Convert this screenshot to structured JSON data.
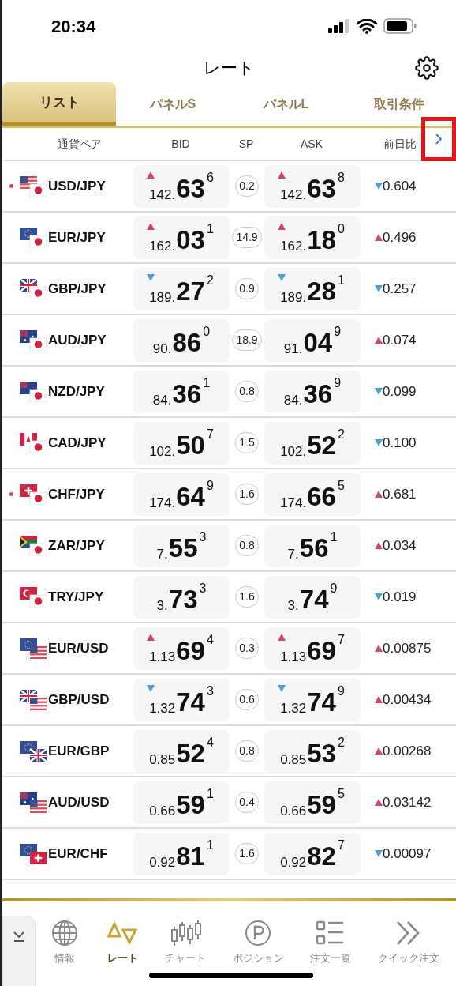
{
  "status_bar": {
    "time": "20:34"
  },
  "header": {
    "title": "レート"
  },
  "tabs": [
    {
      "label": "リスト",
      "selected": true
    },
    {
      "label": "パネルS",
      "selected": false
    },
    {
      "label": "パネルL",
      "selected": false
    },
    {
      "label": "取引条件",
      "selected": false
    }
  ],
  "columns": [
    "通貨ペア",
    "BID",
    "SP",
    "ASK",
    "前日比"
  ],
  "highlighted_next": true,
  "rows": [
    {
      "pair": "USD/JPY",
      "marked": true,
      "flags": [
        {
          "kind": "us"
        },
        {
          "kind": "jp"
        }
      ],
      "bid": {
        "rising": true,
        "falling": false,
        "head": "142.",
        "big": "63",
        "tail": "6"
      },
      "sp": "0.2",
      "ask": {
        "rising": true,
        "falling": false,
        "head": "142.",
        "big": "63",
        "tail": "8"
      },
      "change": {
        "rising": false,
        "value": "0.604"
      }
    },
    {
      "pair": "EUR/JPY",
      "marked": false,
      "flags": [
        {
          "kind": "eu"
        },
        {
          "kind": "jp"
        }
      ],
      "bid": {
        "rising": true,
        "falling": false,
        "head": "162.",
        "big": "03",
        "tail": "1"
      },
      "sp": "14.9",
      "ask": {
        "rising": true,
        "falling": false,
        "head": "162.",
        "big": "18",
        "tail": "0"
      },
      "change": {
        "rising": true,
        "value": "0.496"
      }
    },
    {
      "pair": "GBP/JPY",
      "marked": false,
      "flags": [
        {
          "kind": "gb"
        },
        {
          "kind": "jp"
        }
      ],
      "bid": {
        "rising": false,
        "falling": true,
        "head": "189.",
        "big": "27",
        "tail": "2"
      },
      "sp": "0.9",
      "ask": {
        "rising": false,
        "falling": true,
        "head": "189.",
        "big": "28",
        "tail": "1"
      },
      "change": {
        "rising": false,
        "value": "0.257"
      }
    },
    {
      "pair": "AUD/JPY",
      "marked": false,
      "flags": [
        {
          "kind": "au"
        },
        {
          "kind": "jp"
        }
      ],
      "bid": {
        "rising": false,
        "falling": false,
        "head": "90.",
        "big": "86",
        "tail": "0"
      },
      "sp": "18.9",
      "ask": {
        "rising": false,
        "falling": false,
        "head": "91.",
        "big": "04",
        "tail": "9"
      },
      "change": {
        "rising": true,
        "value": "0.074"
      }
    },
    {
      "pair": "NZD/JPY",
      "marked": false,
      "flags": [
        {
          "kind": "nz"
        },
        {
          "kind": "jp"
        }
      ],
      "bid": {
        "rising": false,
        "falling": false,
        "head": "84.",
        "big": "36",
        "tail": "1"
      },
      "sp": "0.8",
      "ask": {
        "rising": false,
        "falling": false,
        "head": "84.",
        "big": "36",
        "tail": "9"
      },
      "change": {
        "rising": false,
        "value": "0.099"
      }
    },
    {
      "pair": "CAD/JPY",
      "marked": false,
      "flags": [
        {
          "kind": "ca"
        },
        {
          "kind": "jp"
        }
      ],
      "bid": {
        "rising": false,
        "falling": false,
        "head": "102.",
        "big": "50",
        "tail": "7"
      },
      "sp": "1.5",
      "ask": {
        "rising": false,
        "falling": false,
        "head": "102.",
        "big": "52",
        "tail": "2"
      },
      "change": {
        "rising": false,
        "value": "0.100"
      }
    },
    {
      "pair": "CHF/JPY",
      "marked": true,
      "flags": [
        {
          "kind": "ch"
        },
        {
          "kind": "jp"
        }
      ],
      "bid": {
        "rising": false,
        "falling": false,
        "head": "174.",
        "big": "64",
        "tail": "9"
      },
      "sp": "1.6",
      "ask": {
        "rising": false,
        "falling": false,
        "head": "174.",
        "big": "66",
        "tail": "5"
      },
      "change": {
        "rising": true,
        "value": "0.681"
      }
    },
    {
      "pair": "ZAR/JPY",
      "marked": false,
      "flags": [
        {
          "kind": "za"
        },
        {
          "kind": "jp"
        }
      ],
      "bid": {
        "rising": false,
        "falling": false,
        "head": "7.",
        "big": "55",
        "tail": "3"
      },
      "sp": "0.8",
      "ask": {
        "rising": false,
        "falling": false,
        "head": "7.",
        "big": "56",
        "tail": "1"
      },
      "change": {
        "rising": true,
        "value": "0.034"
      }
    },
    {
      "pair": "TRY/JPY",
      "marked": false,
      "flags": [
        {
          "kind": "tr"
        },
        {
          "kind": "jp"
        }
      ],
      "bid": {
        "rising": false,
        "falling": false,
        "head": "3.",
        "big": "73",
        "tail": "3"
      },
      "sp": "1.6",
      "ask": {
        "rising": false,
        "falling": false,
        "head": "3.",
        "big": "74",
        "tail": "9"
      },
      "change": {
        "rising": false,
        "value": "0.019"
      }
    },
    {
      "pair": "EUR/USD",
      "marked": false,
      "flags": [
        {
          "kind": "eu"
        },
        {
          "kind": "us"
        }
      ],
      "bid": {
        "rising": true,
        "falling": false,
        "head": "1.13",
        "big": "69",
        "tail": "4"
      },
      "sp": "0.3",
      "ask": {
        "rising": true,
        "falling": false,
        "head": "1.13",
        "big": "69",
        "tail": "7"
      },
      "change": {
        "rising": true,
        "value": "0.00875"
      }
    },
    {
      "pair": "GBP/USD",
      "marked": false,
      "flags": [
        {
          "kind": "gb"
        },
        {
          "kind": "us"
        }
      ],
      "bid": {
        "rising": false,
        "falling": true,
        "head": "1.32",
        "big": "74",
        "tail": "3"
      },
      "sp": "0.6",
      "ask": {
        "rising": false,
        "falling": true,
        "head": "1.32",
        "big": "74",
        "tail": "9"
      },
      "change": {
        "rising": true,
        "value": "0.00434"
      }
    },
    {
      "pair": "EUR/GBP",
      "marked": false,
      "flags": [
        {
          "kind": "eu"
        },
        {
          "kind": "gb"
        }
      ],
      "bid": {
        "rising": false,
        "falling": false,
        "head": "0.85",
        "big": "52",
        "tail": "4"
      },
      "sp": "0.8",
      "ask": {
        "rising": false,
        "falling": false,
        "head": "0.85",
        "big": "53",
        "tail": "2"
      },
      "change": {
        "rising": true,
        "value": "0.00268"
      }
    },
    {
      "pair": "AUD/USD",
      "marked": false,
      "flags": [
        {
          "kind": "au"
        },
        {
          "kind": "us"
        }
      ],
      "bid": {
        "rising": false,
        "falling": false,
        "head": "0.66",
        "big": "59",
        "tail": "1"
      },
      "sp": "0.4",
      "ask": {
        "rising": false,
        "falling": false,
        "head": "0.66",
        "big": "59",
        "tail": "5"
      },
      "change": {
        "rising": true,
        "value": "0.03142"
      }
    },
    {
      "pair": "EUR/CHF",
      "marked": false,
      "flags": [
        {
          "kind": "eu"
        },
        {
          "kind": "ch"
        }
      ],
      "bid": {
        "rising": false,
        "falling": false,
        "head": "0.92",
        "big": "81",
        "tail": "1"
      },
      "sp": "1.6",
      "ask": {
        "rising": false,
        "falling": false,
        "head": "0.92",
        "big": "82",
        "tail": "7"
      },
      "change": {
        "rising": false,
        "value": "0.00097"
      }
    }
  ],
  "bottom_nav": [
    {
      "kind": "globe",
      "label": "情報",
      "selected": false
    },
    {
      "kind": "rate",
      "label": "レート",
      "selected": true
    },
    {
      "kind": "chart",
      "label": "チャート",
      "selected": false
    },
    {
      "kind": "position",
      "label": "ポジション",
      "selected": false
    },
    {
      "kind": "list",
      "label": "注文一覧",
      "selected": false
    },
    {
      "kind": "quick",
      "label": "クイック注文",
      "selected": false
    }
  ]
}
